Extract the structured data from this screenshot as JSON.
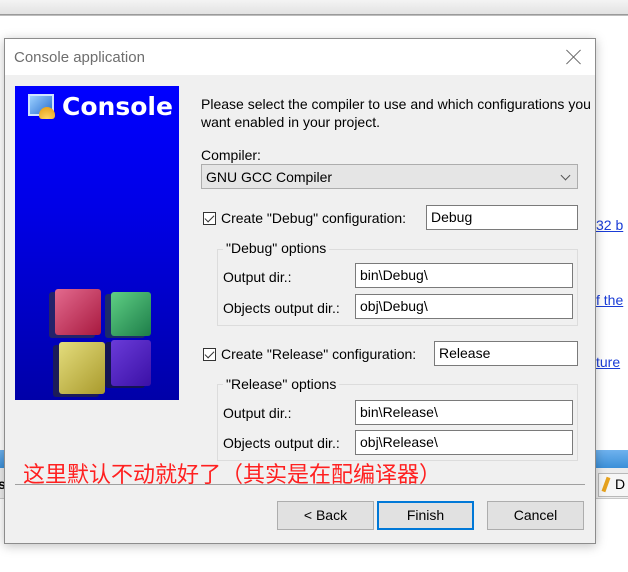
{
  "background": {
    "links": [
      "32 b",
      "f the",
      "ture"
    ],
    "taskbar_tab_label": "D",
    "left_fragment": "s"
  },
  "dialog": {
    "title": "Console application",
    "banner_title": "Console",
    "intro": "Please select the compiler to use and which configurations you want enabled in your project.",
    "compiler": {
      "label": "Compiler:",
      "selected": "GNU GCC Compiler"
    },
    "debug": {
      "checkbox_label": "Create \"Debug\" configuration:",
      "checked": true,
      "name_value": "Debug",
      "group_label": "\"Debug\" options",
      "output_dir_label": "Output dir.:",
      "output_dir_value": "bin\\Debug\\",
      "objects_dir_label": "Objects output dir.:",
      "objects_dir_value": "obj\\Debug\\"
    },
    "release": {
      "checkbox_label": "Create \"Release\" configuration:",
      "checked": true,
      "name_value": "Release",
      "group_label": "\"Release\" options",
      "output_dir_label": "Output dir.:",
      "output_dir_value": "bin\\Release\\",
      "objects_dir_label": "Objects output dir.:",
      "objects_dir_value": "obj\\Release\\"
    },
    "annotation": "这里默认不动就好了（其实是在配编译器）",
    "buttons": {
      "back": "< Back",
      "finish": "Finish",
      "cancel": "Cancel"
    }
  },
  "colors": {
    "annotation": "#ff2020",
    "default_button_border": "#0078d7",
    "banner_blue": "#0000ff"
  }
}
